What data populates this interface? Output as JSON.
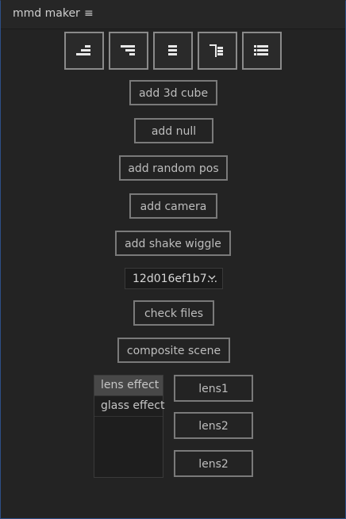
{
  "header": {
    "title": "mmd maker",
    "menu_glyph": "≡"
  },
  "align_buttons": [
    {
      "icon": "align-bottom-right-icon"
    },
    {
      "icon": "align-top-right-icon"
    },
    {
      "icon": "align-center-icon"
    },
    {
      "icon": "align-left-bar-icon"
    },
    {
      "icon": "align-full-lines-icon"
    }
  ],
  "buttons": {
    "add_3d_cube": "add 3d cube",
    "add_null": "add null",
    "add_random_pos": "add random pos",
    "add_camera": "add camera",
    "add_shake_wiggle": "add shake wiggle",
    "check_files": "check files",
    "composite_scene": "composite scene"
  },
  "file_select": {
    "selected": "12d016ef1b7..."
  },
  "effects_list": {
    "items": [
      "lens effect",
      "glass effect"
    ],
    "selected": "lens effect"
  },
  "lens_buttons": [
    "lens1",
    "lens2",
    "lens2"
  ],
  "colors": {
    "background": "#232323",
    "border": "#7a7a7a",
    "text": "#bdbdbd"
  }
}
